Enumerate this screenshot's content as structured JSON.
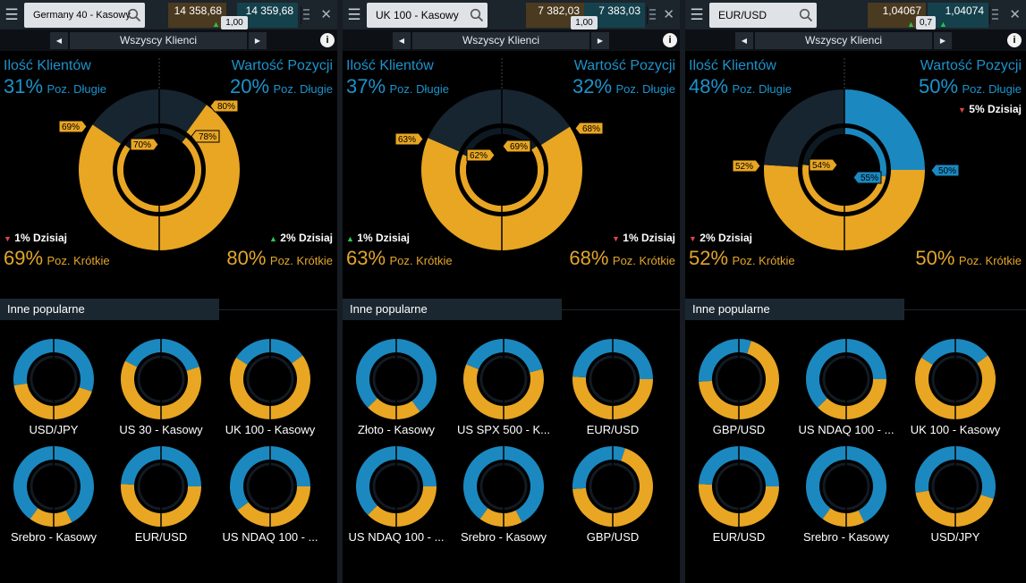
{
  "ui": {
    "nav_label": "Wszyscy Klienci",
    "clients_title": "Ilość Klientów",
    "value_title": "Wartość Pozycji",
    "long_label": "Poz. Długie",
    "short_label": "Poz. Krótkie",
    "popular_label": "Inne popularne",
    "info_glyph": "i",
    "close_glyph": "✕",
    "prev_glyph": "◀",
    "next_glyph": "▶"
  },
  "colors": {
    "long": "#1b89c0",
    "short": "#e8a623",
    "empty": "#172531",
    "bg": "#000000"
  },
  "panels": [
    {
      "instrument": "Germany 40 - Kasowy",
      "bid": "14 358,68",
      "ask": "14 359,68",
      "spread": "1,00",
      "clients_long": "31%",
      "value_long": "20%",
      "today_clients": "1% Dzisiaj",
      "today_clients_dir": "down",
      "today_value": "2% Dzisiaj",
      "today_value_dir": "up",
      "clients_short": "69%",
      "value_short": "80%",
      "clients_short_frac": 0.69,
      "value_short_frac": 0.8,
      "inner_clients_short_frac": 0.7,
      "inner_value_short_frac": 0.78,
      "tag_outer_left": "69%",
      "tag_inner_left": "70%",
      "tag_outer_right": "80%",
      "tag_inner_right": "78%",
      "tag_dir": "short",
      "popular": [
        {
          "name": "USD/JPY",
          "left_short": 0.45,
          "right_short": 0.4
        },
        {
          "name": "US 30 - Kasowy",
          "left_short": 0.65,
          "right_short": 0.6
        },
        {
          "name": "UK 100 - Kasowy",
          "left_short": 0.68,
          "right_short": 0.7
        },
        {
          "name": "Srebro - Kasowy",
          "left_short": 0.2,
          "right_short": 0.15
        },
        {
          "name": "EUR/USD",
          "left_short": 0.52,
          "right_short": 0.5
        },
        {
          "name": "US NDAQ 100 - ...",
          "left_short": 0.3,
          "right_short": 0.5
        }
      ]
    },
    {
      "instrument": "UK 100 - Kasowy",
      "bid": "7 382,03",
      "ask": "7 383,03",
      "spread": "1,00",
      "clients_long": "37%",
      "value_long": "32%",
      "today_clients": "1% Dzisiaj",
      "today_clients_dir": "up",
      "today_value": "1% Dzisiaj",
      "today_value_dir": "down",
      "clients_short": "63%",
      "value_short": "68%",
      "clients_short_frac": 0.63,
      "value_short_frac": 0.68,
      "inner_clients_short_frac": 0.62,
      "inner_value_short_frac": 0.69,
      "tag_outer_left": "63%",
      "tag_inner_left": "62%",
      "tag_outer_right": "68%",
      "tag_inner_right": "69%",
      "tag_dir": "short",
      "popular": [
        {
          "name": "Złoto - Kasowy",
          "left_short": 0.25,
          "right_short": 0.2
        },
        {
          "name": "US SPX 500 - K...",
          "left_short": 0.62,
          "right_short": 0.58
        },
        {
          "name": "EUR/USD",
          "left_short": 0.52,
          "right_short": 0.5
        },
        {
          "name": "US NDAQ 100 - ...",
          "left_short": 0.25,
          "right_short": 0.5
        },
        {
          "name": "Srebro - Kasowy",
          "left_short": 0.2,
          "right_short": 0.15
        },
        {
          "name": "GBP/USD",
          "left_short": 0.48,
          "right_short": 0.9
        }
      ]
    },
    {
      "instrument": "EUR/USD",
      "bid": "1,04067",
      "ask": "1,04074",
      "spread": "0,7",
      "clients_long": "48%",
      "value_long": "50%",
      "today_clients": "2% Dzisiaj",
      "today_clients_dir": "down",
      "today_value": "5% Dzisiaj",
      "today_value_dir": "down",
      "clients_short": "52%",
      "value_short": "50%",
      "clients_short_frac": 0.52,
      "value_short_frac": 0.5,
      "inner_clients_short_frac": 0.54,
      "inner_value_short_frac": 0.45,
      "tag_outer_left": "52%",
      "tag_inner_left": "54%",
      "tag_outer_right": "50%",
      "tag_inner_right": "55%",
      "tag_dir": "long",
      "popular": [
        {
          "name": "GBP/USD",
          "left_short": 0.48,
          "right_short": 0.9
        },
        {
          "name": "US NDAQ 100 - ...",
          "left_short": 0.25,
          "right_short": 0.5
        },
        {
          "name": "UK 100 - Kasowy",
          "left_short": 0.68,
          "right_short": 0.7
        },
        {
          "name": "EUR/USD",
          "left_short": 0.52,
          "right_short": 0.5
        },
        {
          "name": "Srebro - Kasowy",
          "left_short": 0.2,
          "right_short": 0.15
        },
        {
          "name": "USD/JPY",
          "left_short": 0.45,
          "right_short": 0.4
        }
      ]
    }
  ]
}
